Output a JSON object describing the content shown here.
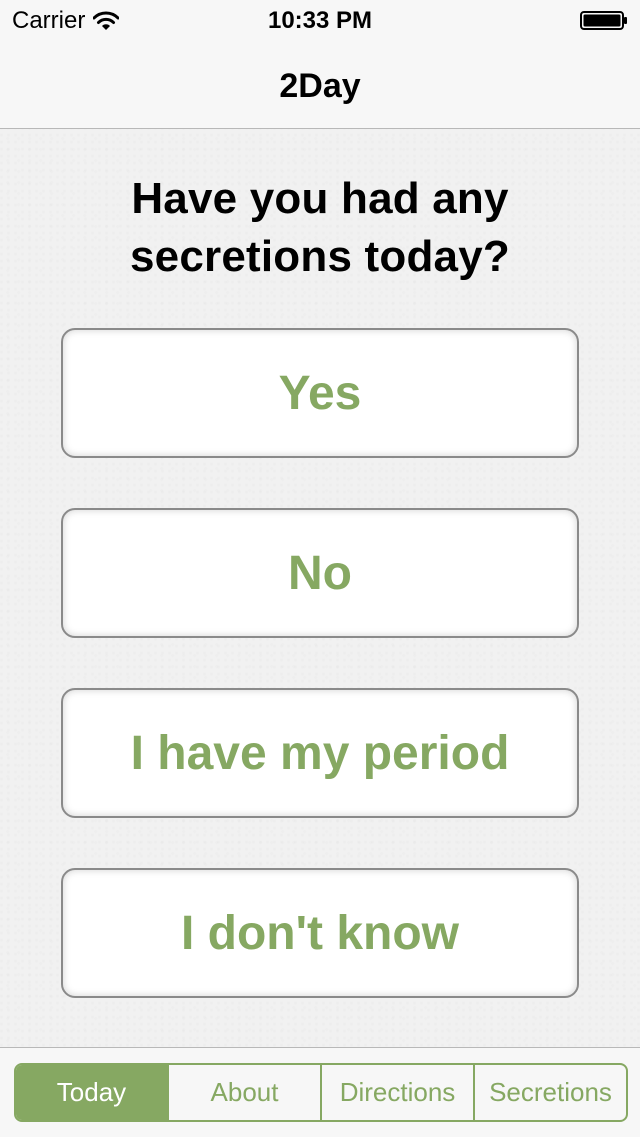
{
  "status_bar": {
    "carrier": "Carrier",
    "time": "10:33 PM",
    "icons": [
      "wifi-icon",
      "battery-icon"
    ]
  },
  "nav": {
    "title": "2Day"
  },
  "question": {
    "line1": "Have you had any",
    "line2": "secretions today?"
  },
  "answers": [
    {
      "label": "Yes"
    },
    {
      "label": "No"
    },
    {
      "label": "I have my period"
    },
    {
      "label": "I don't know"
    }
  ],
  "tabs": [
    {
      "label": "Today",
      "selected": true
    },
    {
      "label": "About",
      "selected": false
    },
    {
      "label": "Directions",
      "selected": false
    },
    {
      "label": "Secretions",
      "selected": false
    }
  ],
  "colors": {
    "accent": "#86a862",
    "background": "#f1f1f1",
    "bar_background": "#f7f7f7",
    "button_border": "#8a8a8a"
  }
}
